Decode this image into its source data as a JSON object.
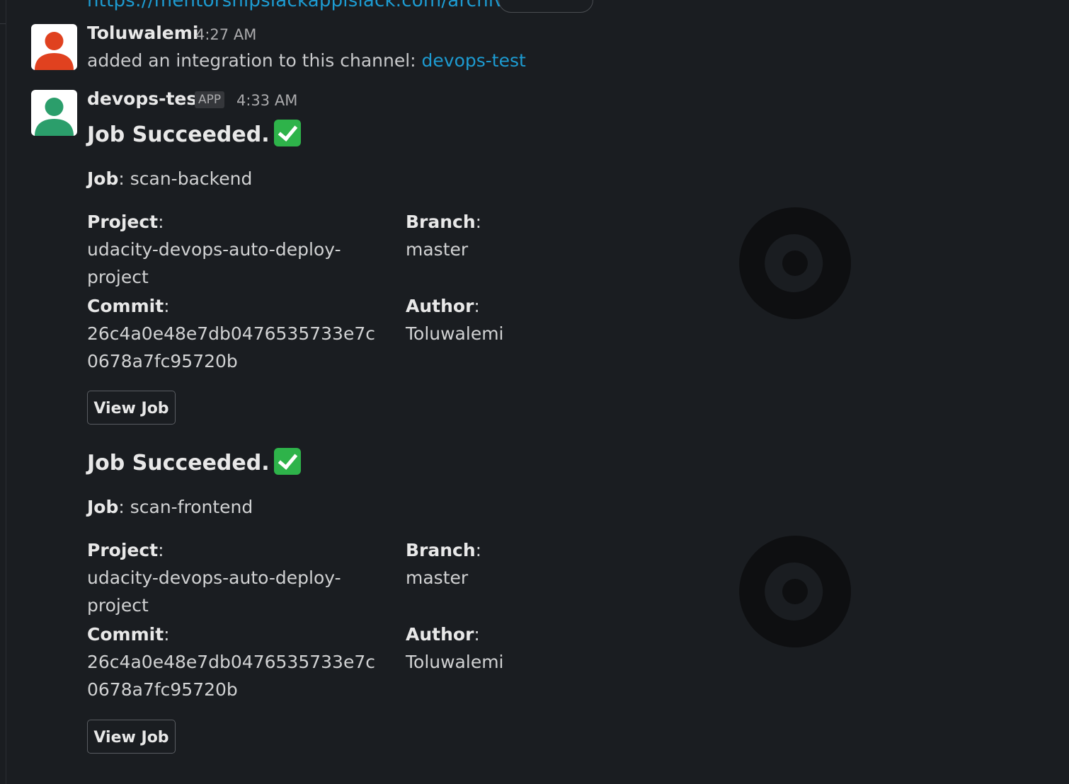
{
  "top": {
    "cut_link": "https://mentorshipslackappislack.com/archives/C               /AP"
  },
  "messages": [
    {
      "author": "Toluwalemi",
      "time": "4:27 AM",
      "text": "added an integration to this channel: ",
      "link": "devops-test",
      "avatar_color": "#e0411f"
    },
    {
      "author": "devops-test",
      "badge": "APP",
      "time": "4:33 AM",
      "avatar_color": "#2b9e6b"
    }
  ],
  "jobs": [
    {
      "headline": "Job Succeeded.",
      "job_label": "Job",
      "job_value": "scan-backend",
      "project_label": "Project",
      "project_value": "udacity-devops-auto-deploy-project",
      "branch_label": "Branch",
      "branch_value": "master",
      "commit_label": "Commit",
      "commit_value": "26c4a0e48e7db0476535733e7c0678a7fc95720b",
      "author_label": "Author",
      "author_value": "Toluwalemi",
      "button": "View Job"
    },
    {
      "headline": "Job Succeeded.",
      "job_label": "Job",
      "job_value": "scan-frontend",
      "project_label": "Project",
      "project_value": "udacity-devops-auto-deploy-project",
      "branch_label": "Branch",
      "branch_value": "master",
      "commit_label": "Commit",
      "commit_value": "26c4a0e48e7db0476535733e7c0678a7fc95720b",
      "author_label": "Author",
      "author_value": "Toluwalemi",
      "button": "View Job"
    }
  ],
  "icons": {
    "success": "white-check-mark-icon",
    "logo": "circleci-logo-icon"
  }
}
